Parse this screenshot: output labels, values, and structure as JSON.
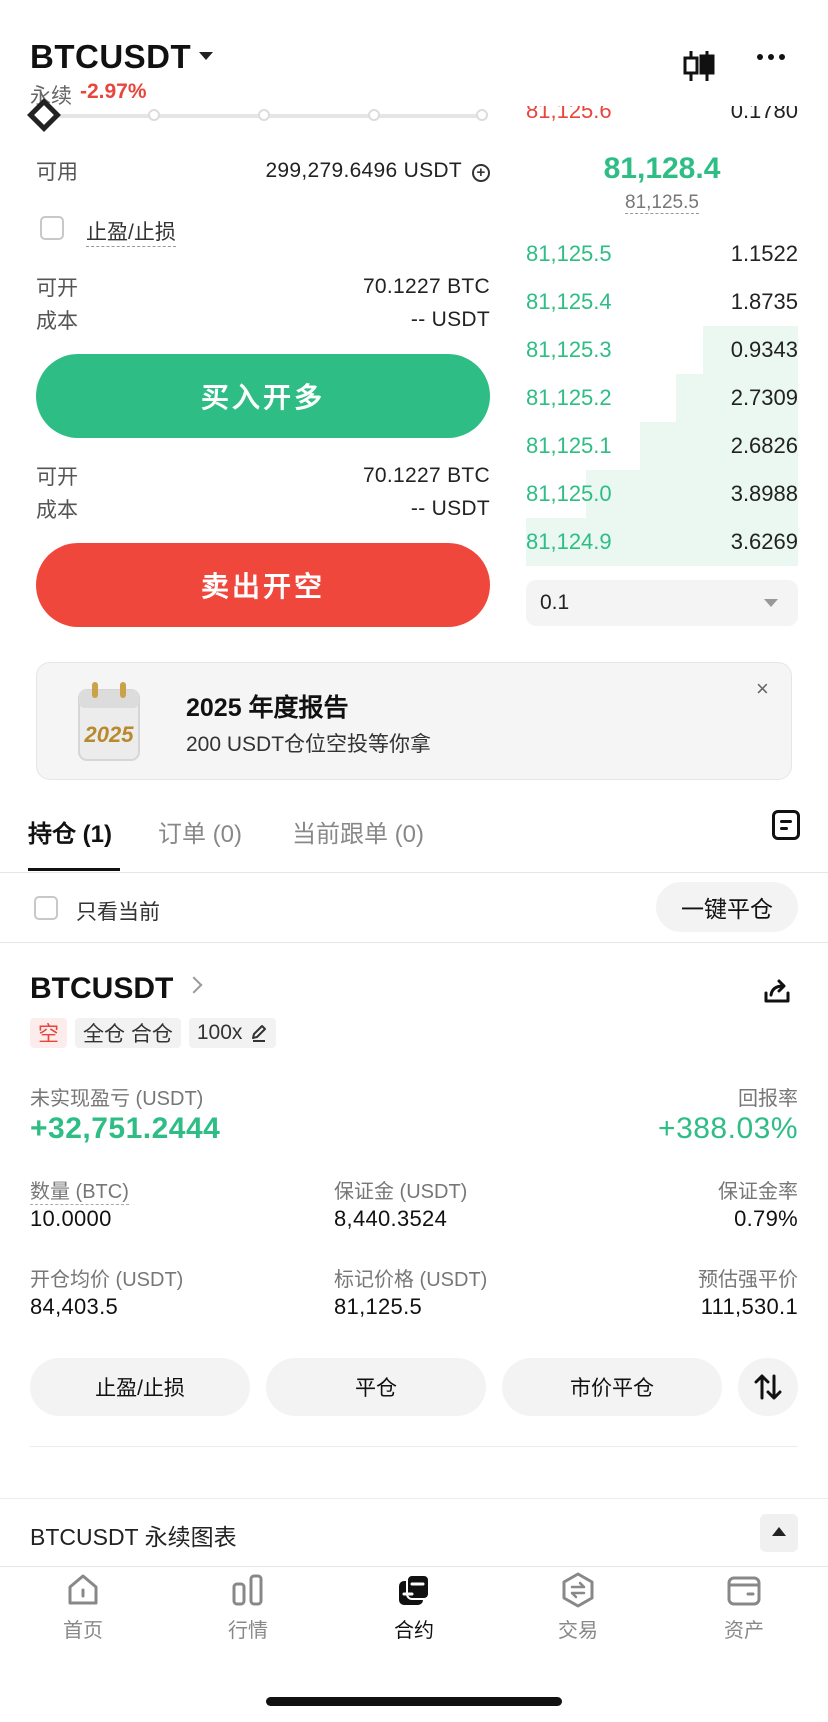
{
  "header": {
    "symbol": "BTCUSDT",
    "type_label": "永续",
    "change": "-2.97%",
    "icons": [
      "kline-icon",
      "more-icon",
      "caret-down-icon"
    ]
  },
  "trade": {
    "available_label": "可用",
    "available_value": "299,279.6496 USDT",
    "tpsl_label": "止盈/止损",
    "long": {
      "open_label": "可开",
      "open_value": "70.1227 BTC",
      "cost_label": "成本",
      "cost_value": "-- USDT"
    },
    "buy_button": "买入开多",
    "short": {
      "open_label": "可开",
      "open_value": "70.1227 BTC",
      "cost_label": "成本",
      "cost_value": "-- USDT"
    },
    "sell_button": "卖出开空"
  },
  "orderbook": {
    "top_partial": {
      "price": "81,125.6",
      "qty": "0.1780"
    },
    "last_price": "81,128.4",
    "mark_price": "81,125.5",
    "bids": [
      {
        "price": "81,125.5",
        "qty": "1.1522",
        "depth": 0.0
      },
      {
        "price": "81,125.4",
        "qty": "1.8735",
        "depth": 0.0
      },
      {
        "price": "81,125.3",
        "qty": "0.9343",
        "depth": 0.35
      },
      {
        "price": "81,125.2",
        "qty": "2.7309",
        "depth": 0.45
      },
      {
        "price": "81,125.1",
        "qty": "2.6826",
        "depth": 0.58
      },
      {
        "price": "81,125.0",
        "qty": "3.8988",
        "depth": 0.78
      },
      {
        "price": "81,124.9",
        "qty": "3.6269",
        "depth": 1.0
      }
    ],
    "depth_value": "0.1"
  },
  "banner": {
    "title": "2025 年度报告",
    "subtitle": "200 USDT仓位空投等你拿",
    "calendar_text": "2025",
    "close": "×"
  },
  "tabs": [
    {
      "label": "持仓 (1)",
      "active": true
    },
    {
      "label": "订单 (0)",
      "active": false
    },
    {
      "label": "当前跟单 (0)",
      "active": false
    }
  ],
  "filter": {
    "only_current": "只看当前",
    "close_all": "一键平仓"
  },
  "position": {
    "symbol": "BTCUSDT",
    "side": "空",
    "margin_mode": "全仓 合仓",
    "leverage": "100x",
    "pnl_label": "未实现盈亏 (USDT)",
    "pnl_value": "+32,751.2444",
    "roe_label": "回报率",
    "roe_value": "+388.03%",
    "qty_label": "数量 (BTC)",
    "qty_value": "10.0000",
    "margin_label": "保证金 (USDT)",
    "margin_value": "8,440.3524",
    "margin_ratio_label": "保证金率",
    "margin_ratio_value": "0.79%",
    "entry_label": "开仓均价 (USDT)",
    "entry_value": "84,403.5",
    "mark_label": "标记价格 (USDT)",
    "mark_value": "81,125.5",
    "liq_label": "预估强平价",
    "liq_value": "111,530.1",
    "actions": [
      "止盈/止损",
      "平仓",
      "市价平仓"
    ]
  },
  "chart_section": {
    "label": "BTCUSDT 永续图表"
  },
  "nav": [
    {
      "label": "首页",
      "icon": "home-icon",
      "active": false
    },
    {
      "label": "行情",
      "icon": "market-icon",
      "active": false
    },
    {
      "label": "合约",
      "icon": "contract-icon",
      "active": true
    },
    {
      "label": "交易",
      "icon": "trade-icon",
      "active": false
    },
    {
      "label": "资产",
      "icon": "wallet-icon",
      "active": false
    }
  ],
  "colors": {
    "green": "#2ebd85",
    "red": "#f0473c",
    "text": "#111111",
    "muted": "#888888"
  }
}
